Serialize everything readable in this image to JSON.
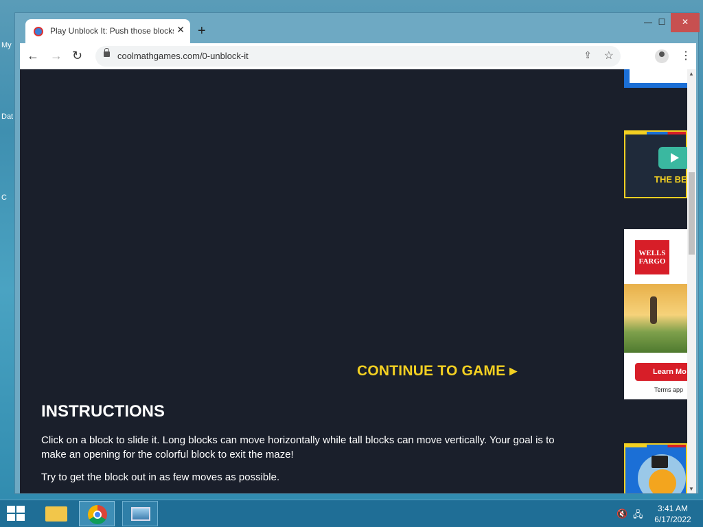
{
  "desktop": {
    "labels": [
      "My",
      "Dat",
      "C"
    ]
  },
  "browser": {
    "tab_title": "Play Unblock It: Push those blocks",
    "tab_close": "✕",
    "new_tab": "+",
    "window_controls": {
      "minimize": "—",
      "maximize": "☐",
      "close": "✕"
    },
    "nav": {
      "back": "←",
      "forward": "→",
      "reload": "↻"
    },
    "url": "coolmathgames.com/0-unblock-it",
    "share_icon": "⇪",
    "star_icon": "☆",
    "menu_icon": "⋮"
  },
  "page": {
    "continue_label": "CONTINUE TO GAME ▸",
    "instructions_heading": "INSTRUCTIONS",
    "instructions_p1": "Click on a block to slide it. Long blocks can move horizontally while tall blocks can move vertically. Your goal is to make an opening for the colorful block to exit the maze!",
    "instructions_p2": "Try to get the block out in as few moves as possible."
  },
  "ads": {
    "video_text": "THE BE",
    "wf_logo_line1": "WELLS",
    "wf_logo_line2": "FARGO",
    "wf_button": "Learn Mo",
    "wf_terms": "Terms app"
  },
  "scrollbar": {
    "up": "▲",
    "down": "▼"
  },
  "taskbar": {
    "time": "3:41 AM",
    "date": "6/17/2022",
    "volume_icon": "🔇",
    "network_icon": "🖧"
  },
  "colors": {
    "accent_yellow": "#f3d022",
    "page_bg": "#1a1f2b",
    "wf_red": "#d71e28"
  }
}
